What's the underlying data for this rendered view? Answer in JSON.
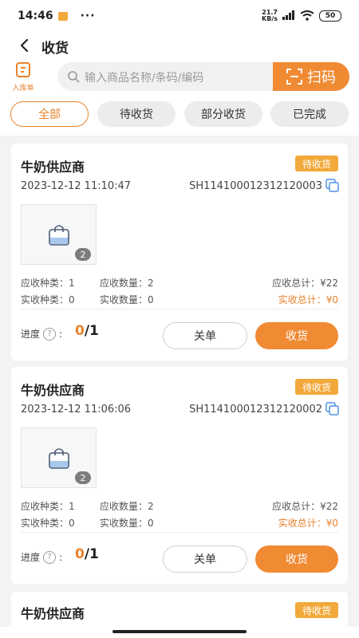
{
  "status_bar": {
    "time": "14:46",
    "dots": "···",
    "net_speed": "21.7",
    "net_unit": "KB/s",
    "battery": "50"
  },
  "nav": {
    "title": "收货"
  },
  "search": {
    "inbound_label": "入库单",
    "placeholder": "输入商品名称/条码/编码",
    "scan_label": "扫码"
  },
  "filters": [
    {
      "label": "全部",
      "active": true
    },
    {
      "label": "待收货",
      "active": false
    },
    {
      "label": "部分收货",
      "active": false
    },
    {
      "label": "已完成",
      "active": false
    }
  ],
  "orders": [
    {
      "supplier": "牛奶供应商",
      "status": "待收货",
      "date": "2023-12-12 11:10:47",
      "order_no": "SH114100012312120003",
      "item_count": "2",
      "expected_types": "应收种类：1",
      "expected_qty": "应收数量：2",
      "expected_total": "应收总计：¥22",
      "actual_types": "实收种类：0",
      "actual_qty": "实收数量：0",
      "actual_total": "实收总计：¥0",
      "progress_label": "进度",
      "progress_done": "0",
      "progress_total": "/1",
      "close_label": "关单",
      "receive_label": "收货"
    },
    {
      "supplier": "牛奶供应商",
      "status": "待收货",
      "date": "2023-12-12 11:06:06",
      "order_no": "SH114100012312120002",
      "item_count": "2",
      "expected_types": "应收种类：1",
      "expected_qty": "应收数量：2",
      "expected_total": "应收总计：¥22",
      "actual_types": "实收种类：0",
      "actual_qty": "实收数量：0",
      "actual_total": "实收总计：¥0",
      "progress_label": "进度",
      "progress_done": "0",
      "progress_total": "/1",
      "close_label": "关单",
      "receive_label": "收货"
    },
    {
      "supplier": "牛奶供应商",
      "status": "待收货"
    }
  ],
  "colors": {
    "accent": "#f08a33",
    "badge": "#f2a93b",
    "background": "#f3f3f3"
  }
}
